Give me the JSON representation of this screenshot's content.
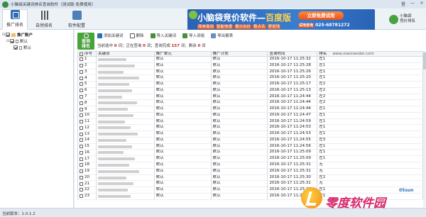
{
  "window": {
    "title": "小脑袋关键词排名查询软件（测试版-免费使用）",
    "controls": [
      "登录",
      "—",
      "×"
    ]
  },
  "nav": {
    "tabs": [
      {
        "id": "rank",
        "label": "推广排名",
        "icon": "rank-icon",
        "active": true
      },
      {
        "id": "natural",
        "label": "自然排名",
        "icon": "bar-chart-icon",
        "active": false
      },
      {
        "id": "software",
        "label": "软件配置",
        "icon": "settings-icon",
        "active": false
      }
    ]
  },
  "banner": {
    "title_main": "小脑袋竞价软件",
    "title_sep": "—",
    "title_edition": "百度版",
    "features": [
      "简单易用",
      "智能快速",
      "报分出价",
      "稳点名",
      "更省钱"
    ],
    "cta": "立即免费试用",
    "phone_label": "试用咨询",
    "phone": "025-68781272"
  },
  "brand": {
    "line1": "小脑袋",
    "line2": "竞价排名"
  },
  "tree": {
    "root": "推广账户",
    "child": "默认",
    "leaf": "默认"
  },
  "toolbar": {
    "query": "查询\n排名",
    "query_line1": "查询",
    "query_line2": "排名",
    "add": "添加关键词",
    "delete": "删除",
    "import_kw": "导入关键词",
    "import_plan": "导入词组",
    "export": "导出报表"
  },
  "status": {
    "prefix": "当前选中",
    "selected": "0",
    "mid1": "词；正在查询",
    "querying": "0",
    "mid2": "词；查询完成",
    "done": "157",
    "mid3": "词；剩余",
    "remain": "0",
    "suffix": "词",
    "url": "www.xiaonaodai.com"
  },
  "table": {
    "headers": {
      "no": "序号",
      "keyword": "关键词",
      "unit": "推广单元",
      "plan": "推广计划",
      "time": "查询时间",
      "rank": "排名"
    },
    "rows": [
      {
        "no": "1",
        "unit": "默认",
        "plan": "默认",
        "time": "2016-10-17 11:25:32",
        "rank": "左1"
      },
      {
        "no": "2",
        "unit": "默认",
        "plan": "默认",
        "time": "2016-10-17 11:25:28",
        "rank": "左1"
      },
      {
        "no": "3",
        "unit": "默认",
        "plan": "默认",
        "time": "2016-10-17 11:25:26",
        "rank": "左1"
      },
      {
        "no": "4",
        "unit": "默认",
        "plan": "默认",
        "time": "2016-10-17 11:25:20",
        "rank": "左1"
      },
      {
        "no": "5",
        "unit": "默认",
        "plan": "默认",
        "time": "2016-10-17 11:25:17",
        "rank": "左2"
      },
      {
        "no": "6",
        "unit": "默认",
        "plan": "默认",
        "time": "2016-10-17 11:25:13",
        "rank": "左2"
      },
      {
        "no": "7",
        "unit": "默认",
        "plan": "默认",
        "time": "2016-10-17 11:24:44",
        "rank": "左2"
      },
      {
        "no": "8",
        "unit": "默认",
        "plan": "默认",
        "time": "2016-10-17 11:24:44",
        "rank": "左2"
      },
      {
        "no": "9",
        "unit": "默认",
        "plan": "默认",
        "time": "2016-10-17 11:24:44",
        "rank": "左1"
      },
      {
        "no": "10",
        "unit": "默认",
        "plan": "默认",
        "time": "2016-10-17 11:24:47",
        "rank": "左1"
      },
      {
        "no": "11",
        "unit": "默认",
        "plan": "默认",
        "time": "2016-10-17 11:24:59",
        "rank": "左1"
      },
      {
        "no": "12",
        "unit": "默认",
        "plan": "默认",
        "time": "2016-10-17 11:24:53",
        "rank": "左1"
      },
      {
        "no": "13",
        "unit": "默认",
        "plan": "默认",
        "time": "2016-10-17 11:24:53",
        "rank": "左1"
      },
      {
        "no": "14",
        "unit": "默认",
        "plan": "默认",
        "time": "2016-10-17 11:24:55",
        "rank": "左3"
      },
      {
        "no": "15",
        "unit": "默认",
        "plan": "默认",
        "time": "2016-10-17 11:24:56",
        "rank": "左1"
      },
      {
        "no": "16",
        "unit": "默认",
        "plan": "默认",
        "time": "2016-10-17 11:25:09",
        "rank": "左1"
      },
      {
        "no": "17",
        "unit": "默认",
        "plan": "默认",
        "time": "2016-10-17 11:25:09",
        "rank": "左1"
      },
      {
        "no": "18",
        "unit": "默认",
        "plan": "默认",
        "time": "2016-10-17 11:25:31",
        "rank": "无"
      },
      {
        "no": "19",
        "unit": "默认",
        "plan": "默认",
        "time": "2016-10-17 11:25:31",
        "rank": "无"
      },
      {
        "no": "20",
        "unit": "默认",
        "plan": "默认",
        "time": "2016-10-17 11:25:30",
        "rank": "左2"
      },
      {
        "no": "21",
        "unit": "默认",
        "plan": "默认",
        "time": "2016-10-17 11:25:31",
        "rank": "无"
      },
      {
        "no": "22",
        "unit": "默认",
        "plan": "默认",
        "time": "2016-10-17 11:25:31",
        "rank": "左1"
      },
      {
        "no": "23",
        "unit": "默认",
        "plan": "默认",
        "time": "2016-10-17 11:25:32",
        "rank": "左1"
      }
    ]
  },
  "statusbar": {
    "version_label": "当前版本：",
    "version": "1.0.1.2"
  },
  "watermark": {
    "text": "零度软件园",
    "site": "05sun"
  },
  "colors": {
    "accent_green": "#4aa23a",
    "banner_blue": "#2a62b4",
    "status_red": "#d01f1f",
    "watermark_pink": "#d6286a"
  }
}
